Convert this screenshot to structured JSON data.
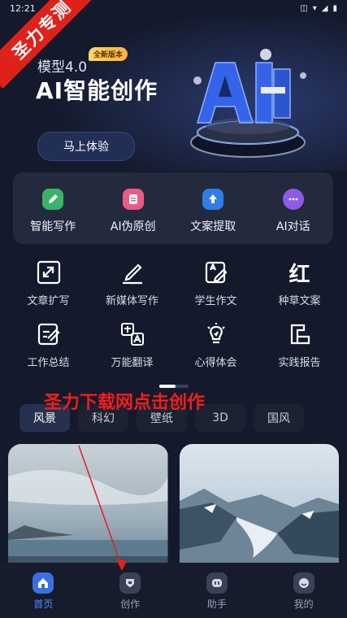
{
  "status": {
    "time": "12:21"
  },
  "ribbon": {
    "text": "圣力专测"
  },
  "banner": {
    "badge": "全新版本",
    "model": "模型4.0",
    "headline": "AI智能创作",
    "cta": "马上体验"
  },
  "quick": [
    {
      "label": "智能写作",
      "color": "#39b36a",
      "icon": "pen-icon"
    },
    {
      "label": "AI伪原创",
      "color": "#ec5a86",
      "icon": "document-icon"
    },
    {
      "label": "文案提取",
      "color": "#2f7de6",
      "icon": "upload-icon"
    },
    {
      "label": "AI对话",
      "color": "#8d5be8",
      "icon": "chat-icon"
    }
  ],
  "tools": [
    {
      "label": "文章扩写",
      "icon": "expand-icon"
    },
    {
      "label": "新媒体写作",
      "icon": "write-line-icon"
    },
    {
      "label": "学生作文",
      "icon": "essay-icon"
    },
    {
      "label": "种草文案",
      "icon": "red-text-icon",
      "glyph": "红"
    },
    {
      "label": "工作总结",
      "icon": "summary-icon"
    },
    {
      "label": "万能翻译",
      "icon": "translate-icon"
    },
    {
      "label": "心得体会",
      "icon": "bulb-icon"
    },
    {
      "label": "实践报告",
      "icon": "report-icon"
    }
  ],
  "watermark": "圣力下载网点击创作",
  "tabs": [
    {
      "label": "风景",
      "active": true
    },
    {
      "label": "科幻"
    },
    {
      "label": "壁纸"
    },
    {
      "label": "3D"
    },
    {
      "label": "国风"
    }
  ],
  "nav": [
    {
      "label": "首页",
      "active": true,
      "icon": "home-icon"
    },
    {
      "label": "创作",
      "icon": "create-icon"
    },
    {
      "label": "助手",
      "icon": "assistant-icon"
    },
    {
      "label": "我的",
      "icon": "profile-icon"
    }
  ]
}
